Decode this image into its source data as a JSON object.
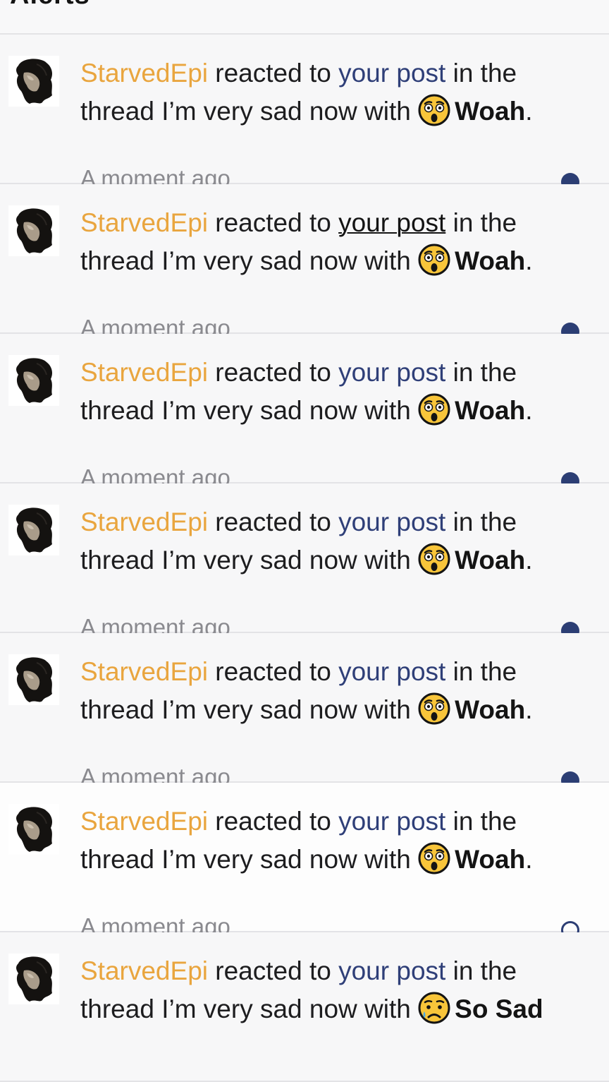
{
  "header": {
    "title": "Alerts"
  },
  "alerts": [
    {
      "user": "StarvedEpi",
      "verb": " reacted to ",
      "link": "your post",
      "middle": " in the thread I’m very sad now with ",
      "reaction": "Woah",
      "reaction_icon": "astonished-emoji-icon",
      "end": ".",
      "time": "A moment ago",
      "unread": true
    },
    {
      "user": "StarvedEpi",
      "verb": " reacted to ",
      "link": "your post",
      "middle": " in the thread I’m very sad now with ",
      "reaction": "Woah",
      "reaction_icon": "astonished-emoji-icon",
      "end": ".",
      "time": "A moment ago",
      "unread": true
    },
    {
      "user": "StarvedEpi",
      "verb": " reacted to ",
      "link": "your post",
      "middle": " in the thread I’m very sad now with ",
      "reaction": "Woah",
      "reaction_icon": "astonished-emoji-icon",
      "end": ".",
      "time": "A moment ago",
      "unread": true
    },
    {
      "user": "StarvedEpi",
      "verb": " reacted to ",
      "link": "your post",
      "middle": " in the thread I’m very sad now with ",
      "reaction": "Woah",
      "reaction_icon": "astonished-emoji-icon",
      "end": ".",
      "time": "A moment ago",
      "unread": true
    },
    {
      "user": "StarvedEpi",
      "verb": " reacted to ",
      "link": "your post",
      "middle": " in the thread I’m very sad now with ",
      "reaction": "Woah",
      "reaction_icon": "astonished-emoji-icon",
      "end": ".",
      "time": "A moment ago",
      "unread": true
    },
    {
      "user": "StarvedEpi",
      "verb": " reacted to ",
      "link": "your post",
      "middle": " in the thread I’m very sad now with ",
      "reaction": "Woah",
      "reaction_icon": "astonished-emoji-icon",
      "end": ".",
      "time": "A moment ago",
      "unread": false
    },
    {
      "user": "StarvedEpi",
      "verb": " reacted to ",
      "link": "your post",
      "middle": " in the thread I’m very sad now with ",
      "reaction": "So Sad",
      "reaction_icon": "sad-tear-emoji-icon",
      "end": "",
      "time": "",
      "unread": true
    }
  ],
  "colors": {
    "username": "#e9a53e",
    "link": "#2f3f78",
    "unread_dot": "#2c3e74",
    "timestamp": "#8a8a8f"
  }
}
